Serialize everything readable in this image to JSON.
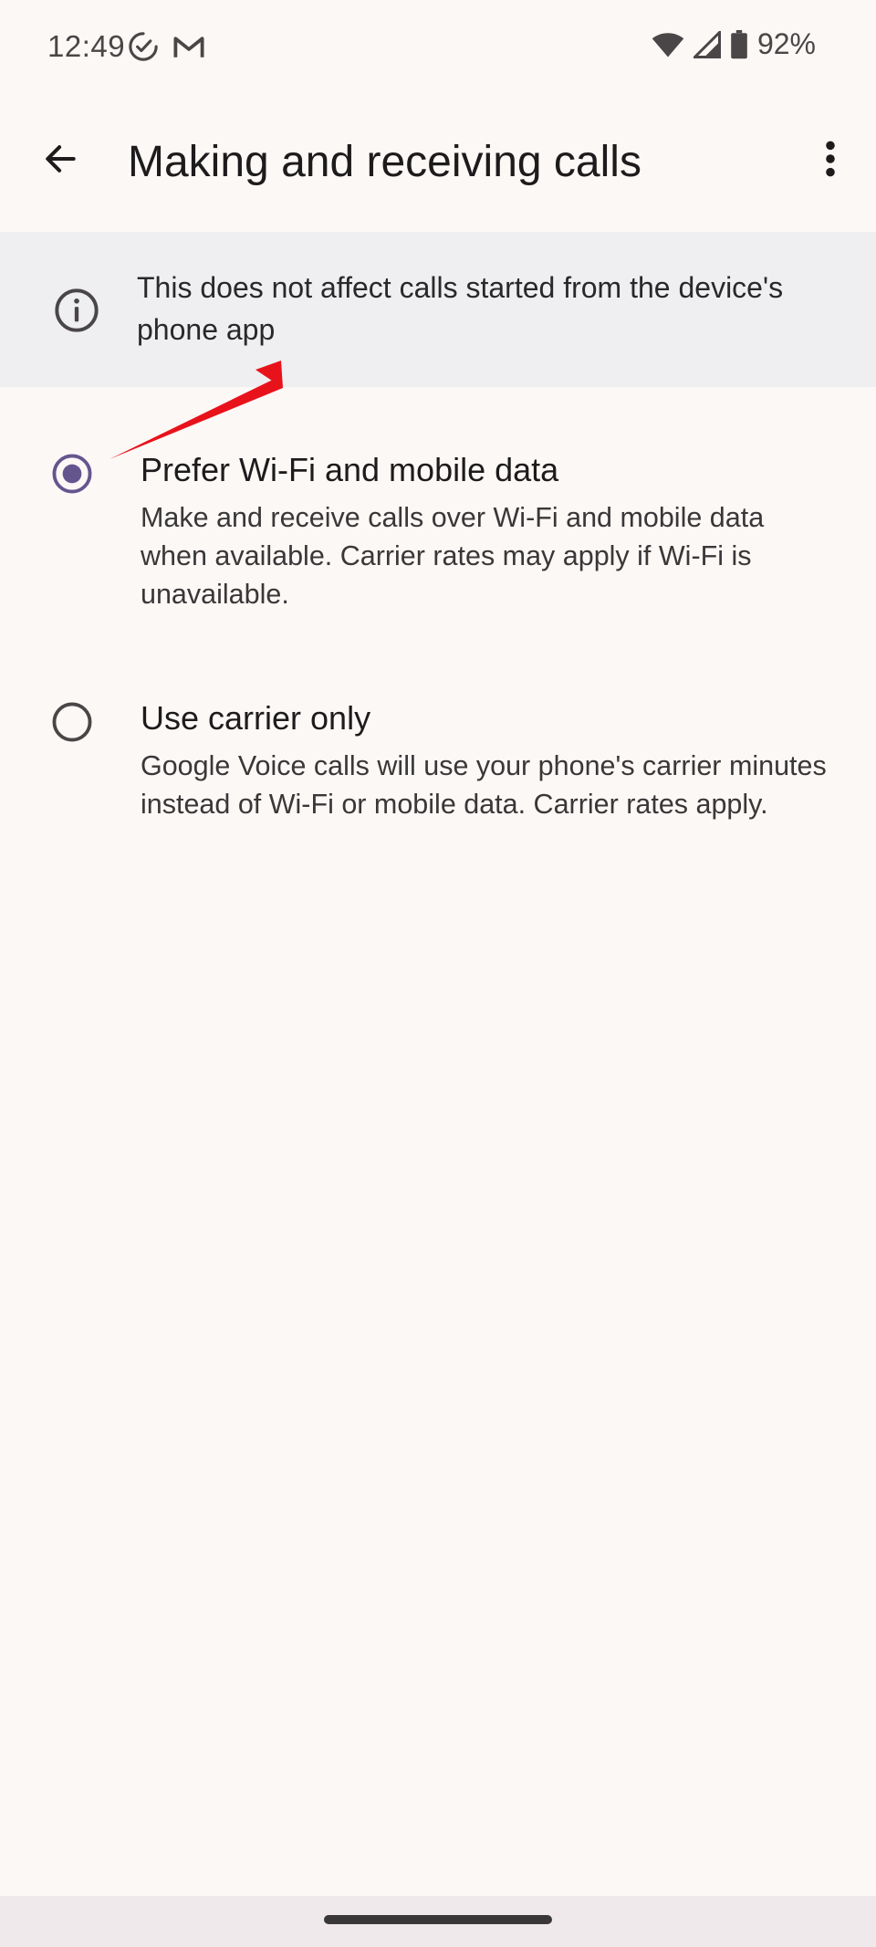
{
  "status_bar": {
    "time": "12:49",
    "battery": "92%",
    "left_icons": [
      "check-circle-icon",
      "gmail-icon"
    ],
    "right_icons": [
      "wifi-icon",
      "cell-signal-icon",
      "battery-icon"
    ]
  },
  "app_bar": {
    "title": "Making and receiving calls",
    "back_icon": "arrow-left-icon",
    "overflow_icon": "more-vert-icon"
  },
  "info_banner": {
    "text": "This does not affect calls started from the device's phone app",
    "icon": "info-icon"
  },
  "options": [
    {
      "title": "Prefer Wi-Fi and mobile data",
      "description": "Make and receive calls over Wi-Fi and mobile data when available. Carrier rates may apply if Wi-Fi is unavailable.",
      "selected": true
    },
    {
      "title": "Use carrier only",
      "description": "Google Voice calls will use your phone's carrier minutes instead of Wi-Fi or mobile data. Carrier rates apply.",
      "selected": false
    }
  ],
  "colors": {
    "accent": "#65558f",
    "background": "#fcf8f6",
    "banner": "#efeff1",
    "annotation": "#e8121b"
  }
}
